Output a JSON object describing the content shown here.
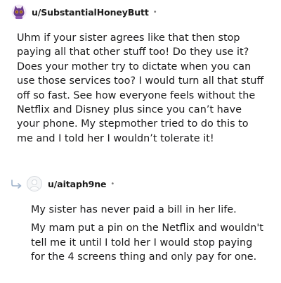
{
  "comments": [
    {
      "username": "u/SubstantialHoneyButt",
      "separator": "•",
      "avatar_icon": "cat-avatar-icon",
      "text": "Uhm if your sister agrees like that then stop paying all that other stuff too! Do they use it? Does your mother try to dictate when you can use those services too? I would turn all that stuff off so fast. See how everyone feels without the Netflix and Disney plus since you can’t have your phone. My stepmother tried to do this to me and I told her I wouldn’t tolerate it!"
    },
    {
      "username": "u/aitaph9ne",
      "separator": "•",
      "avatar_icon": "default-avatar-icon",
      "reply_icon": "reply-arrow-icon",
      "paragraphs": [
        "My sister has never paid a bill in her life.",
        "My mam put a pin on the Netflix and wouldn't tell me it until I told her I would stop paying for the 4 screens thing and only pay for one."
      ]
    }
  ],
  "colors": {
    "text": "#1a1a1b",
    "meta": "#7c7c7c",
    "avatar_purple": "#6a3d8c",
    "avatar_orange": "#f5a623"
  }
}
